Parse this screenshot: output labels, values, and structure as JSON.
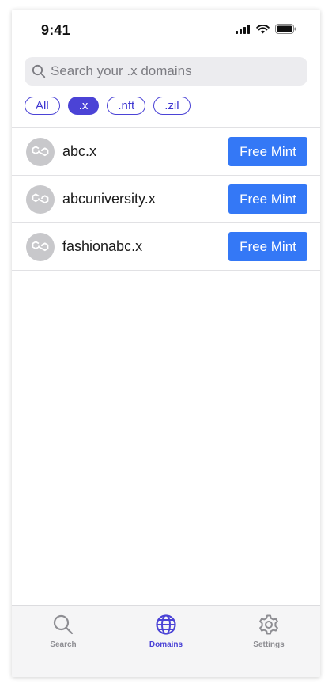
{
  "status_bar": {
    "time": "9:41"
  },
  "search": {
    "placeholder": "Search your .x domains",
    "value": ""
  },
  "filters": [
    {
      "label": "All",
      "active": false
    },
    {
      "label": ".x",
      "active": true
    },
    {
      "label": ".nft",
      "active": false
    },
    {
      "label": ".zil",
      "active": false
    }
  ],
  "domains": [
    {
      "name": "abc.x",
      "action": "Free Mint"
    },
    {
      "name": "abcuniversity.x",
      "action": "Free Mint"
    },
    {
      "name": "fashionabc.x",
      "action": "Free Mint"
    }
  ],
  "tabbar": {
    "tabs": [
      {
        "label": "Search",
        "icon": "search-icon",
        "active": false
      },
      {
        "label": "Domains",
        "icon": "globe-icon",
        "active": true
      },
      {
        "label": "Settings",
        "icon": "gear-icon",
        "active": false
      }
    ]
  },
  "colors": {
    "accent": "#4b43d6",
    "button": "#3478f6",
    "inactive": "#8e8e93"
  }
}
